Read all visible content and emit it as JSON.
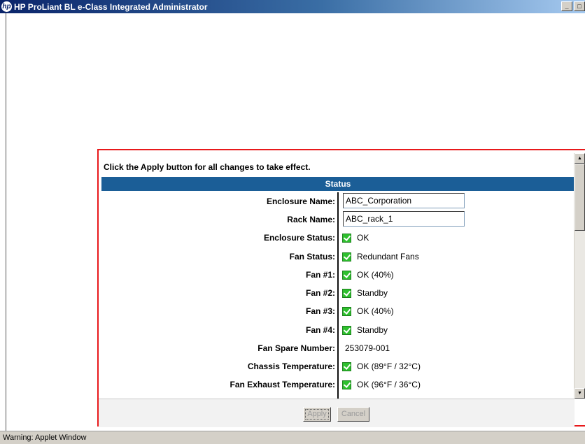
{
  "window": {
    "title": "HP ProLiant BL e-Class Integrated Administrator",
    "logo_text": "hp",
    "controls": {
      "minimize": "_",
      "maximize": "□"
    }
  },
  "panel": {
    "instruction": "Click the Apply button for all changes to take effect.",
    "section_header": "Status",
    "fields": {
      "enclosure_name": {
        "label": "Enclosure Name:",
        "value": "ABC_Corporation"
      },
      "rack_name": {
        "label": "Rack Name:",
        "value": "ABC_rack_1"
      },
      "enclosure_status": {
        "label": "Enclosure Status:",
        "value": "OK"
      },
      "fan_status": {
        "label": "Fan Status:",
        "value": "Redundant Fans"
      },
      "fan1": {
        "label": "Fan #1:",
        "value": "OK  (40%)"
      },
      "fan2": {
        "label": "Fan #2:",
        "value": "Standby"
      },
      "fan3": {
        "label": "Fan #3:",
        "value": "OK  (40%)"
      },
      "fan4": {
        "label": "Fan #4:",
        "value": "Standby"
      },
      "fan_spare_number": {
        "label": "Fan Spare Number:",
        "value": "253079-001"
      },
      "chassis_temperature": {
        "label": "Chassis Temperature:",
        "value": "OK  (89°F / 32°C)"
      },
      "fan_exhaust_temperature": {
        "label": "Fan Exhaust Temperature:",
        "value": "OK  (96°F / 36°C)"
      }
    },
    "buttons": {
      "apply": "Apply",
      "cancel": "Cancel"
    },
    "status_icon": "green-check-icon",
    "colors": {
      "header_bg": "#1b5e97",
      "panel_border": "#e8191b",
      "ok_green": "#2ec02e"
    }
  },
  "statusbar": {
    "text": "Warning: Applet Window"
  }
}
